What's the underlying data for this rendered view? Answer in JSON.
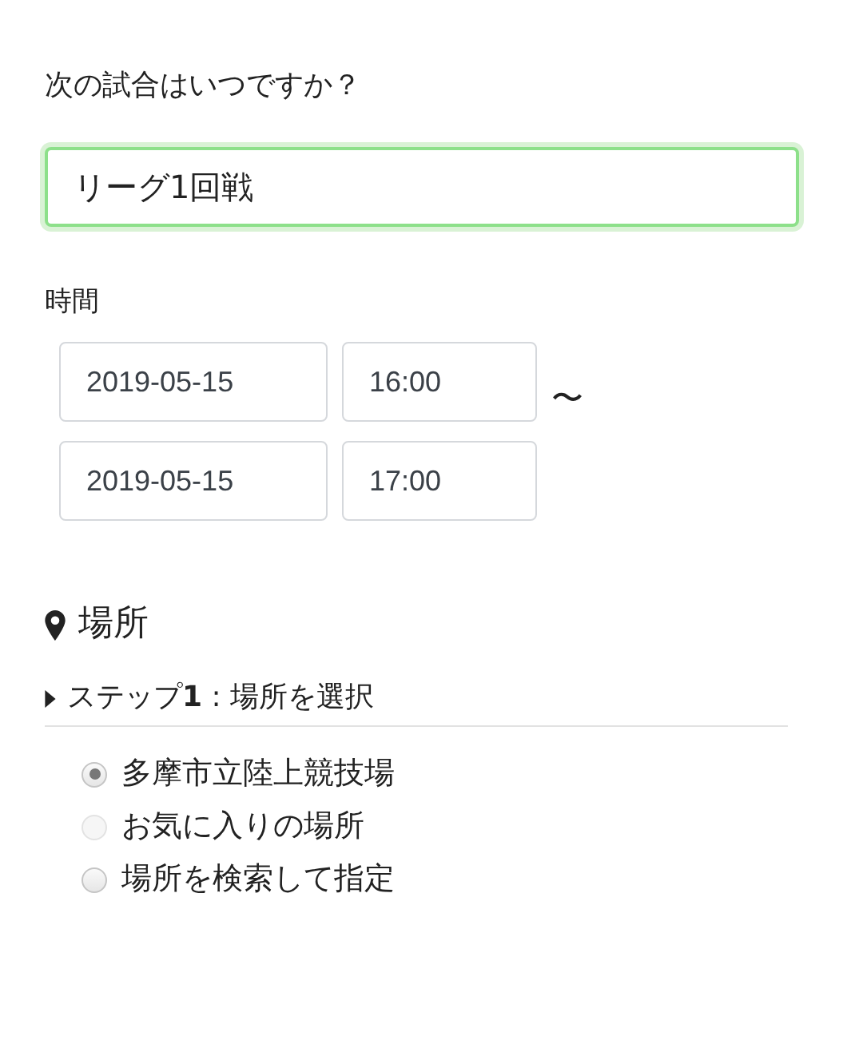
{
  "question": {
    "label": "次の試合はいつですか？",
    "value": "リーグ1回戦",
    "focused": true
  },
  "time": {
    "label": "時間",
    "start": {
      "date": "2019-05-15",
      "time": "16:00"
    },
    "separator": "〜",
    "end": {
      "date": "2019-05-15",
      "time": "17:00"
    }
  },
  "location": {
    "heading": "場所",
    "step": {
      "label": "ステップ**1** : 場所を選択",
      "expanded": false
    },
    "options": [
      {
        "label": "多摩市立陸上競技場",
        "selected": true,
        "disabled": false
      },
      {
        "label": "お気に入りの場所",
        "selected": false,
        "disabled": true
      },
      {
        "label": "場所を検索して指定",
        "selected": false,
        "disabled": false
      }
    ]
  }
}
